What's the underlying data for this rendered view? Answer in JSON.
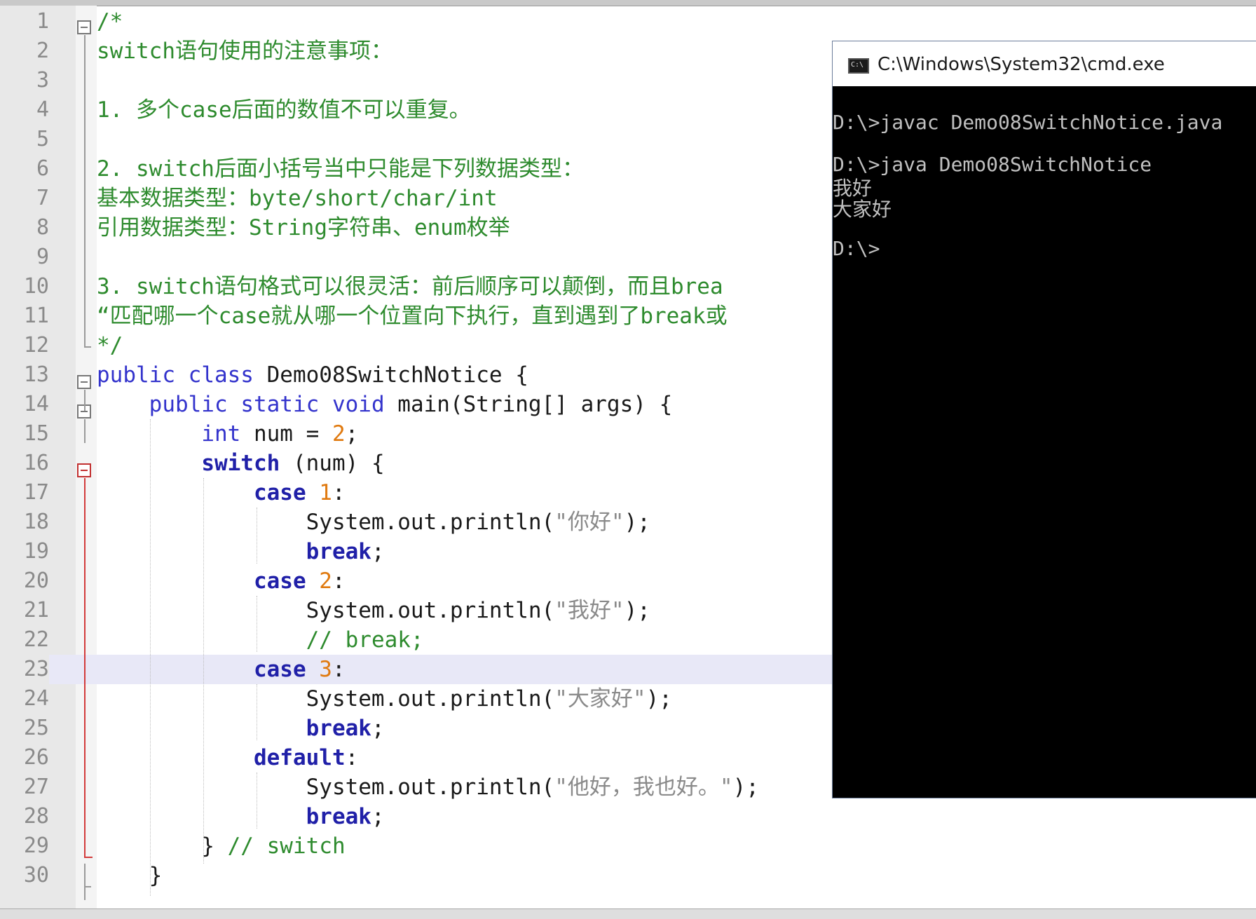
{
  "editor": {
    "lines": [
      {
        "n": "1",
        "tokens": [
          {
            "t": "/*",
            "c": "cm"
          }
        ]
      },
      {
        "n": "2",
        "tokens": [
          {
            "t": "switch语句使用的注意事项：",
            "c": "cm"
          }
        ]
      },
      {
        "n": "3",
        "tokens": []
      },
      {
        "n": "4",
        "tokens": [
          {
            "t": "1. 多个case后面的数值不可以重复。",
            "c": "cm"
          }
        ]
      },
      {
        "n": "5",
        "tokens": []
      },
      {
        "n": "6",
        "tokens": [
          {
            "t": "2. switch后面小括号当中只能是下列数据类型：",
            "c": "cm"
          }
        ]
      },
      {
        "n": "7",
        "tokens": [
          {
            "t": "基本数据类型：byte/short/char/int",
            "c": "cm"
          }
        ]
      },
      {
        "n": "8",
        "tokens": [
          {
            "t": "引用数据类型：String字符串、enum枚举",
            "c": "cm"
          }
        ]
      },
      {
        "n": "9",
        "tokens": []
      },
      {
        "n": "10",
        "tokens": [
          {
            "t": "3. switch语句格式可以很灵活：前后顺序可以颠倒，而且brea",
            "c": "cm"
          }
        ]
      },
      {
        "n": "11",
        "tokens": [
          {
            "t": "“匹配哪一个case就从哪一个位置向下执行，直到遇到了break或",
            "c": "cm"
          }
        ]
      },
      {
        "n": "12",
        "tokens": [
          {
            "t": "*/",
            "c": "cm"
          }
        ]
      },
      {
        "n": "13",
        "tokens": [
          {
            "t": "public ",
            "c": "kw"
          },
          {
            "t": "class ",
            "c": "kw"
          },
          {
            "t": "Demo08SwitchNotice {",
            "c": "tx"
          }
        ]
      },
      {
        "n": "14",
        "tokens": [
          {
            "t": "    ",
            "c": "tx"
          },
          {
            "t": "public ",
            "c": "kw"
          },
          {
            "t": "static ",
            "c": "kw"
          },
          {
            "t": "void ",
            "c": "kw"
          },
          {
            "t": "main(String[] args) {",
            "c": "tx"
          }
        ]
      },
      {
        "n": "15",
        "tokens": [
          {
            "t": "        ",
            "c": "tx"
          },
          {
            "t": "int ",
            "c": "kw"
          },
          {
            "t": "num = ",
            "c": "tx"
          },
          {
            "t": "2",
            "c": "num"
          },
          {
            "t": ";",
            "c": "tx"
          }
        ]
      },
      {
        "n": "16",
        "tokens": [
          {
            "t": "        ",
            "c": "tx"
          },
          {
            "t": "switch",
            "c": "kb"
          },
          {
            "t": " (num) {",
            "c": "tx"
          }
        ]
      },
      {
        "n": "17",
        "tokens": [
          {
            "t": "            ",
            "c": "tx"
          },
          {
            "t": "case",
            "c": "kb"
          },
          {
            "t": " ",
            "c": "tx"
          },
          {
            "t": "1",
            "c": "num"
          },
          {
            "t": ":",
            "c": "tx"
          }
        ]
      },
      {
        "n": "18",
        "tokens": [
          {
            "t": "                System.out.println(",
            "c": "tx"
          },
          {
            "t": "\"你好\"",
            "c": "str"
          },
          {
            "t": ");",
            "c": "tx"
          }
        ]
      },
      {
        "n": "19",
        "tokens": [
          {
            "t": "                ",
            "c": "tx"
          },
          {
            "t": "break",
            "c": "kb"
          },
          {
            "t": ";",
            "c": "tx"
          }
        ]
      },
      {
        "n": "20",
        "tokens": [
          {
            "t": "            ",
            "c": "tx"
          },
          {
            "t": "case",
            "c": "kb"
          },
          {
            "t": " ",
            "c": "tx"
          },
          {
            "t": "2",
            "c": "num"
          },
          {
            "t": ":",
            "c": "tx"
          }
        ]
      },
      {
        "n": "21",
        "tokens": [
          {
            "t": "                System.out.println(",
            "c": "tx"
          },
          {
            "t": "\"我好\"",
            "c": "str"
          },
          {
            "t": ");",
            "c": "tx"
          }
        ]
      },
      {
        "n": "22",
        "tokens": [
          {
            "t": "                ",
            "c": "tx"
          },
          {
            "t": "// break;",
            "c": "cm"
          }
        ]
      },
      {
        "n": "23",
        "tokens": [
          {
            "t": "            ",
            "c": "tx"
          },
          {
            "t": "case",
            "c": "kb"
          },
          {
            "t": " ",
            "c": "tx"
          },
          {
            "t": "3",
            "c": "num"
          },
          {
            "t": ":",
            "c": "tx"
          }
        ]
      },
      {
        "n": "24",
        "tokens": [
          {
            "t": "                System.out.println(",
            "c": "tx"
          },
          {
            "t": "\"大家好\"",
            "c": "str"
          },
          {
            "t": ");",
            "c": "tx"
          }
        ]
      },
      {
        "n": "25",
        "tokens": [
          {
            "t": "                ",
            "c": "tx"
          },
          {
            "t": "break",
            "c": "kb"
          },
          {
            "t": ";",
            "c": "tx"
          }
        ]
      },
      {
        "n": "26",
        "tokens": [
          {
            "t": "            ",
            "c": "tx"
          },
          {
            "t": "default",
            "c": "kb"
          },
          {
            "t": ":",
            "c": "tx"
          }
        ]
      },
      {
        "n": "27",
        "tokens": [
          {
            "t": "                System.out.println(",
            "c": "tx"
          },
          {
            "t": "\"他好，我也好。\"",
            "c": "str"
          },
          {
            "t": ");",
            "c": "tx"
          }
        ]
      },
      {
        "n": "28",
        "tokens": [
          {
            "t": "                ",
            "c": "tx"
          },
          {
            "t": "break",
            "c": "kb"
          },
          {
            "t": ";",
            "c": "tx"
          }
        ]
      },
      {
        "n": "29",
        "tokens": [
          {
            "t": "        } ",
            "c": "tx"
          },
          {
            "t": "// switch",
            "c": "cm"
          }
        ]
      },
      {
        "n": "30",
        "tokens": [
          {
            "t": "    }",
            "c": "tx"
          }
        ]
      }
    ],
    "current_line": "23",
    "colors": {
      "comment": "#2e8b2e",
      "keyword": "#3333cc",
      "number": "#e07a10",
      "string": "#8a8a8a"
    }
  },
  "console": {
    "title": "C:\\Windows\\System32\\cmd.exe",
    "icon": "cmd-icon",
    "icon_text": "C:\\",
    "lines": [
      "",
      "D:\\>javac Demo08SwitchNotice.java",
      "",
      "D:\\>java Demo08SwitchNotice",
      "我好",
      "大家好",
      "",
      "D:\\>"
    ]
  }
}
